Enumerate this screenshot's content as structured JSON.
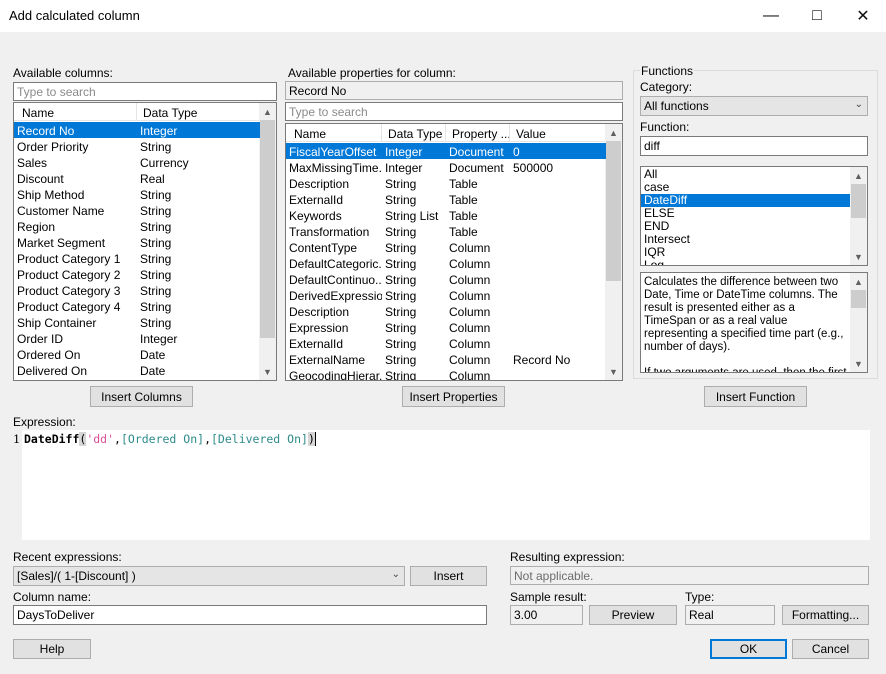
{
  "window": {
    "title": "Add calculated column",
    "minimize_icon": "minimize-icon",
    "maximize_icon": "maximize-icon",
    "close_icon": "close-icon"
  },
  "columns": {
    "label": "Available columns:",
    "search_placeholder": "Type to search",
    "headers": [
      "Name",
      "Data Type"
    ],
    "rows": [
      [
        "Record No",
        "Integer"
      ],
      [
        "Order Priority",
        "String"
      ],
      [
        "Sales",
        "Currency"
      ],
      [
        "Discount",
        "Real"
      ],
      [
        "Ship Method",
        "String"
      ],
      [
        "Customer Name",
        "String"
      ],
      [
        "Region",
        "String"
      ],
      [
        "Market Segment",
        "String"
      ],
      [
        "Product Category 1",
        "String"
      ],
      [
        "Product Category 2",
        "String"
      ],
      [
        "Product Category 3",
        "String"
      ],
      [
        "Product Category 4",
        "String"
      ],
      [
        "Ship Container",
        "String"
      ],
      [
        "Order ID",
        "Integer"
      ],
      [
        "Ordered On",
        "Date"
      ],
      [
        "Delivered On",
        "Date"
      ]
    ],
    "insert_label": "Insert Columns"
  },
  "properties": {
    "label": "Available properties for column:",
    "column": "Record No",
    "search_placeholder": "Type to search",
    "headers": [
      "Name",
      "Data Type",
      "Property ...",
      "Value"
    ],
    "rows": [
      [
        "FiscalYearOffset",
        "Integer",
        "Document",
        "0"
      ],
      [
        "MaxMissingTime...",
        "Integer",
        "Document",
        "500000"
      ],
      [
        "Description",
        "String",
        "Table",
        ""
      ],
      [
        "ExternalId",
        "String",
        "Table",
        ""
      ],
      [
        "Keywords",
        "String List",
        "Table",
        ""
      ],
      [
        "Transformation",
        "String",
        "Table",
        ""
      ],
      [
        "ContentType",
        "String",
        "Column",
        ""
      ],
      [
        "DefaultCategoric...",
        "String",
        "Column",
        ""
      ],
      [
        "DefaultContinuo...",
        "String",
        "Column",
        ""
      ],
      [
        "DerivedExpression",
        "String",
        "Column",
        ""
      ],
      [
        "Description",
        "String",
        "Column",
        ""
      ],
      [
        "Expression",
        "String",
        "Column",
        ""
      ],
      [
        "ExternalId",
        "String",
        "Column",
        ""
      ],
      [
        "ExternalName",
        "String",
        "Column",
        "Record No"
      ],
      [
        "GeocodingHierar...",
        "String",
        "Column",
        ""
      ]
    ],
    "insert_label": "Insert Properties"
  },
  "functions": {
    "group_label": "Functions",
    "category_label": "Category:",
    "category_value": "All functions",
    "function_label": "Function:",
    "function_value": "diff",
    "list": [
      "All",
      "case",
      "DateDiff",
      "ELSE",
      "END",
      "Intersect",
      "IQR",
      "Log"
    ],
    "selected_index": 2,
    "description": "Calculates the difference between two Date, Time or DateTime columns. The result is presented either as a TimeSpan or as a real value representing a specified time part (e.g., number of days).\n\nIf two arguments are used, then the first argument is the start date and the second the",
    "insert_label": "Insert Function"
  },
  "expression": {
    "label": "Expression:",
    "line_number": "1",
    "fn": "DateDiff",
    "open": "(",
    "arg1": "'dd'",
    "comma1": ",",
    "arg2": "[Ordered On]",
    "comma2": ",",
    "arg3": "[Delivered On]",
    "close": ")"
  },
  "recent": {
    "label": "Recent expressions:",
    "value": "[Sales]/( 1-[Discount] )",
    "insert_label": "Insert"
  },
  "resulting": {
    "label": "Resulting expression:",
    "value": "Not applicable."
  },
  "column_name": {
    "label": "Column name:",
    "value": "DaysToDeliver"
  },
  "sample": {
    "label": "Sample result:",
    "value": "3.00",
    "preview_label": "Preview"
  },
  "type": {
    "label": "Type:",
    "value": "Real",
    "formatting_label": "Formatting..."
  },
  "footer": {
    "help": "Help",
    "ok": "OK",
    "cancel": "Cancel"
  },
  "colors": {
    "selection": "#0078d7",
    "code_fn": "#000000",
    "code_string": "#d9509a",
    "code_column": "#2e8b8b"
  }
}
